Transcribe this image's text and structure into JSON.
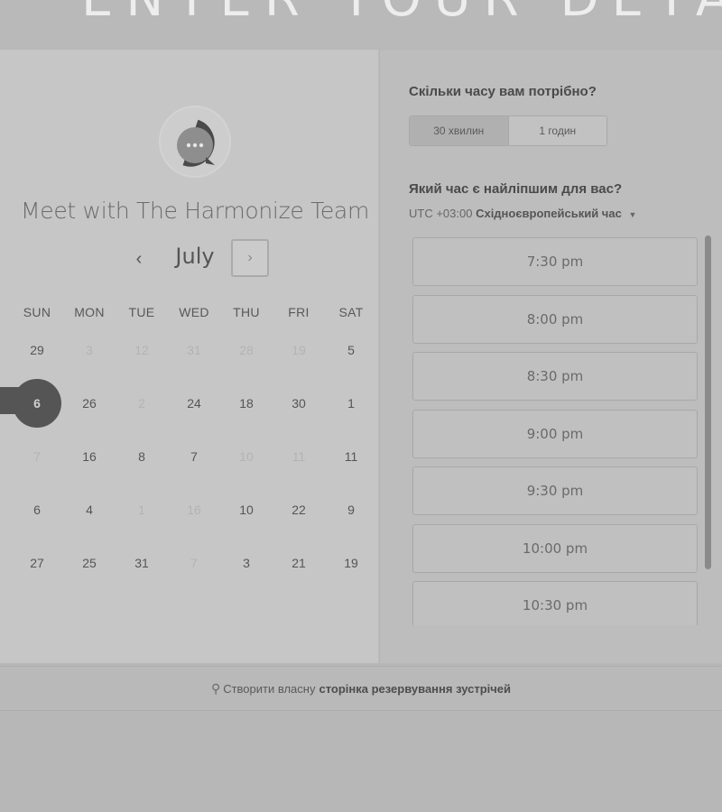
{
  "banner": {
    "heading": "ENTER YOUR DETAILS"
  },
  "organizer": {
    "title": "Meet with The Harmonize Team",
    "avatar_icon": "chat-bubble-icon"
  },
  "calendar": {
    "month": "July",
    "prev_icon": "‹",
    "next_icon": "›",
    "weekdays": [
      "SUN",
      "MON",
      "TUE",
      "WED",
      "THU",
      "FRI",
      "SAT"
    ],
    "weeks": [
      [
        {
          "d": "29",
          "dim": false
        },
        {
          "d": "3",
          "dim": true
        },
        {
          "d": "12",
          "dim": true
        },
        {
          "d": "31",
          "dim": true
        },
        {
          "d": "28",
          "dim": true
        },
        {
          "d": "19",
          "dim": true
        },
        {
          "d": "5",
          "dim": false
        }
      ],
      [
        {
          "d": "6",
          "dim": false,
          "selected": true
        },
        {
          "d": "26",
          "dim": false
        },
        {
          "d": "2",
          "dim": true
        },
        {
          "d": "24",
          "dim": false
        },
        {
          "d": "18",
          "dim": false
        },
        {
          "d": "30",
          "dim": false
        },
        {
          "d": "1",
          "dim": false
        }
      ],
      [
        {
          "d": "7",
          "dim": true
        },
        {
          "d": "16",
          "dim": false
        },
        {
          "d": "8",
          "dim": false
        },
        {
          "d": "7",
          "dim": false
        },
        {
          "d": "10",
          "dim": true
        },
        {
          "d": "11",
          "dim": true
        },
        {
          "d": "11",
          "dim": false
        }
      ],
      [
        {
          "d": "6",
          "dim": false
        },
        {
          "d": "4",
          "dim": false
        },
        {
          "d": "1",
          "dim": true
        },
        {
          "d": "16",
          "dim": true
        },
        {
          "d": "10",
          "dim": false
        },
        {
          "d": "22",
          "dim": false
        },
        {
          "d": "9",
          "dim": false
        }
      ],
      [
        {
          "d": "27",
          "dim": false
        },
        {
          "d": "25",
          "dim": false
        },
        {
          "d": "31",
          "dim": false
        },
        {
          "d": "7",
          "dim": true
        },
        {
          "d": "3",
          "dim": false
        },
        {
          "d": "21",
          "dim": false
        },
        {
          "d": "19",
          "dim": false
        }
      ]
    ]
  },
  "duration": {
    "title": "Скільки часу вам потрібно?",
    "options": [
      {
        "label": "30 хвилин",
        "active": true
      },
      {
        "label": "1 годин",
        "active": false
      }
    ]
  },
  "time_selection": {
    "title": "Який час є найліпшим для вас?",
    "timezone_offset": "UTC +03:00",
    "timezone_name": "Східноєвропейський час",
    "slots": [
      "7:30 pm",
      "8:00 pm",
      "8:30 pm",
      "9:00 pm",
      "9:30 pm",
      "10:00 pm",
      "10:30 pm"
    ]
  },
  "footer": {
    "icon": "hubspot-sprocket-icon",
    "text_regular": "Створити власну",
    "text_bold": "сторінка резервування зустрічей"
  }
}
